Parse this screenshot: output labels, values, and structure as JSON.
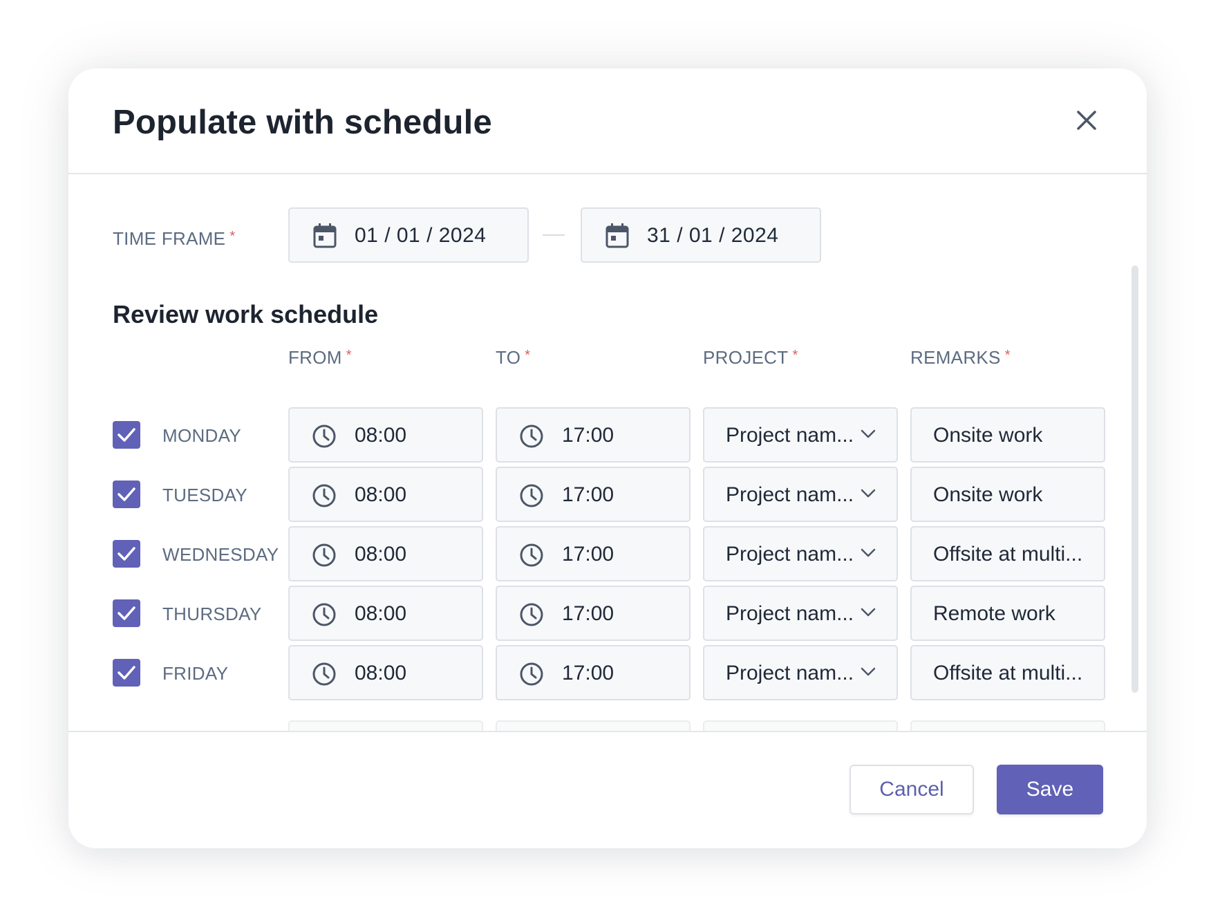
{
  "dialog": {
    "title": "Populate with schedule",
    "close_icon": "close-icon"
  },
  "time_frame": {
    "label": "TIME FRAME",
    "required_mark": "*",
    "start_date": "01 / 01 / 2024",
    "end_date": "31 / 01 / 2024",
    "icon": "calendar-icon"
  },
  "schedule": {
    "section_title": "Review work schedule",
    "columns": {
      "from": "FROM",
      "to": "TO",
      "project": "PROJECT",
      "remarks": "REMARKS",
      "required_mark": "*"
    },
    "rows": [
      {
        "day": "MONDAY",
        "checked": true,
        "from": "08:00",
        "to": "17:00",
        "project": "Project nam...",
        "remarks": "Onsite work"
      },
      {
        "day": "TUESDAY",
        "checked": true,
        "from": "08:00",
        "to": "17:00",
        "project": "Project nam...",
        "remarks": "Onsite work"
      },
      {
        "day": "WEDNESDAY",
        "checked": true,
        "from": "08:00",
        "to": "17:00",
        "project": "Project nam...",
        "remarks": "Offsite at multi..."
      },
      {
        "day": "THURSDAY",
        "checked": true,
        "from": "08:00",
        "to": "17:00",
        "project": "Project nam...",
        "remarks": "Remote work"
      },
      {
        "day": "FRIDAY",
        "checked": true,
        "from": "08:00",
        "to": "17:00",
        "project": "Project nam...",
        "remarks": "Offsite at multi..."
      }
    ]
  },
  "footer": {
    "cancel_label": "Cancel",
    "save_label": "Save"
  },
  "colors": {
    "accent": "#6061b7",
    "required": "#e05d5d",
    "label": "#5c6b80",
    "field_bg": "#f7f8fa",
    "field_border": "#dde1e6"
  }
}
